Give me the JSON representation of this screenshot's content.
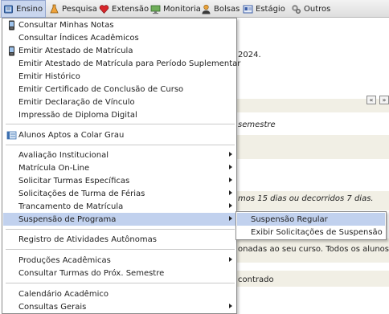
{
  "menubar": {
    "items": [
      {
        "label": "Ensino",
        "icon": "book-icon"
      },
      {
        "label": "Pesquisa",
        "icon": "flask-icon"
      },
      {
        "label": "Extensão",
        "icon": "heart-icon"
      },
      {
        "label": "Monitoria",
        "icon": "monitor-icon"
      },
      {
        "label": "Bolsas",
        "icon": "person-icon"
      },
      {
        "label": "Estágio",
        "icon": "id-card-icon"
      },
      {
        "label": "Outros",
        "icon": "gears-icon"
      }
    ]
  },
  "ensino_menu": {
    "items": [
      {
        "label": "Consultar Minhas Notas",
        "icon": "phone-icon",
        "submenu": false
      },
      {
        "label": "Consultar Índices Acadêmicos",
        "icon": "",
        "submenu": false
      },
      {
        "label": "Emitir Atestado de Matrícula",
        "icon": "phone-icon",
        "submenu": false
      },
      {
        "label": "Emitir Atestado de Matrícula para Período Suplementar",
        "icon": "",
        "submenu": false
      },
      {
        "label": "Emitir Histórico",
        "icon": "",
        "submenu": false
      },
      {
        "label": "Emitir Certificado de Conclusão de Curso",
        "icon": "",
        "submenu": false
      },
      {
        "label": "Emitir Declaração de Vínculo",
        "icon": "",
        "submenu": false
      },
      {
        "label": "Impressão de Diploma Digital",
        "icon": "",
        "submenu": false
      },
      {
        "label": "Alunos Aptos a Colar Grau",
        "icon": "list-icon",
        "submenu": false
      },
      {
        "label": "Avaliação Institucional",
        "icon": "",
        "submenu": true
      },
      {
        "label": "Matrícula On-Line",
        "icon": "",
        "submenu": true
      },
      {
        "label": "Solicitar Turmas Específicas",
        "icon": "",
        "submenu": true
      },
      {
        "label": "Solicitações de Turma de Férias",
        "icon": "",
        "submenu": true
      },
      {
        "label": "Trancamento de Matrícula",
        "icon": "",
        "submenu": true
      },
      {
        "label": "Suspensão de Programa",
        "icon": "",
        "submenu": true
      },
      {
        "label": "Registro de Atividades Autônomas",
        "icon": "",
        "submenu": false
      },
      {
        "label": "Produções Acadêmicas",
        "icon": "",
        "submenu": true
      },
      {
        "label": "Consultar Turmas do Próx. Semestre",
        "icon": "",
        "submenu": false
      },
      {
        "label": "Calendário Acadêmico",
        "icon": "",
        "submenu": false
      },
      {
        "label": "Consultas Gerais",
        "icon": "",
        "submenu": true
      }
    ]
  },
  "suspensao_submenu": {
    "items": [
      {
        "label": "Suspensão Regular"
      },
      {
        "label": "Exibir Solicitações de Suspensão"
      }
    ]
  },
  "background": {
    "year_text": "2024.",
    "pager_prev": "«",
    "pager_next": "»",
    "semestre_text": "semestre",
    "dias_text": "mos 15 dias ou decorridos 7 dias.",
    "curso_text": "onadas ao seu curso. Todos os alunos do",
    "encontrado_text": "contrado"
  },
  "colors": {
    "highlight": "#c1d1ee",
    "menubar_active": "#c9d6ee",
    "page_strip": "#f1efe5"
  }
}
